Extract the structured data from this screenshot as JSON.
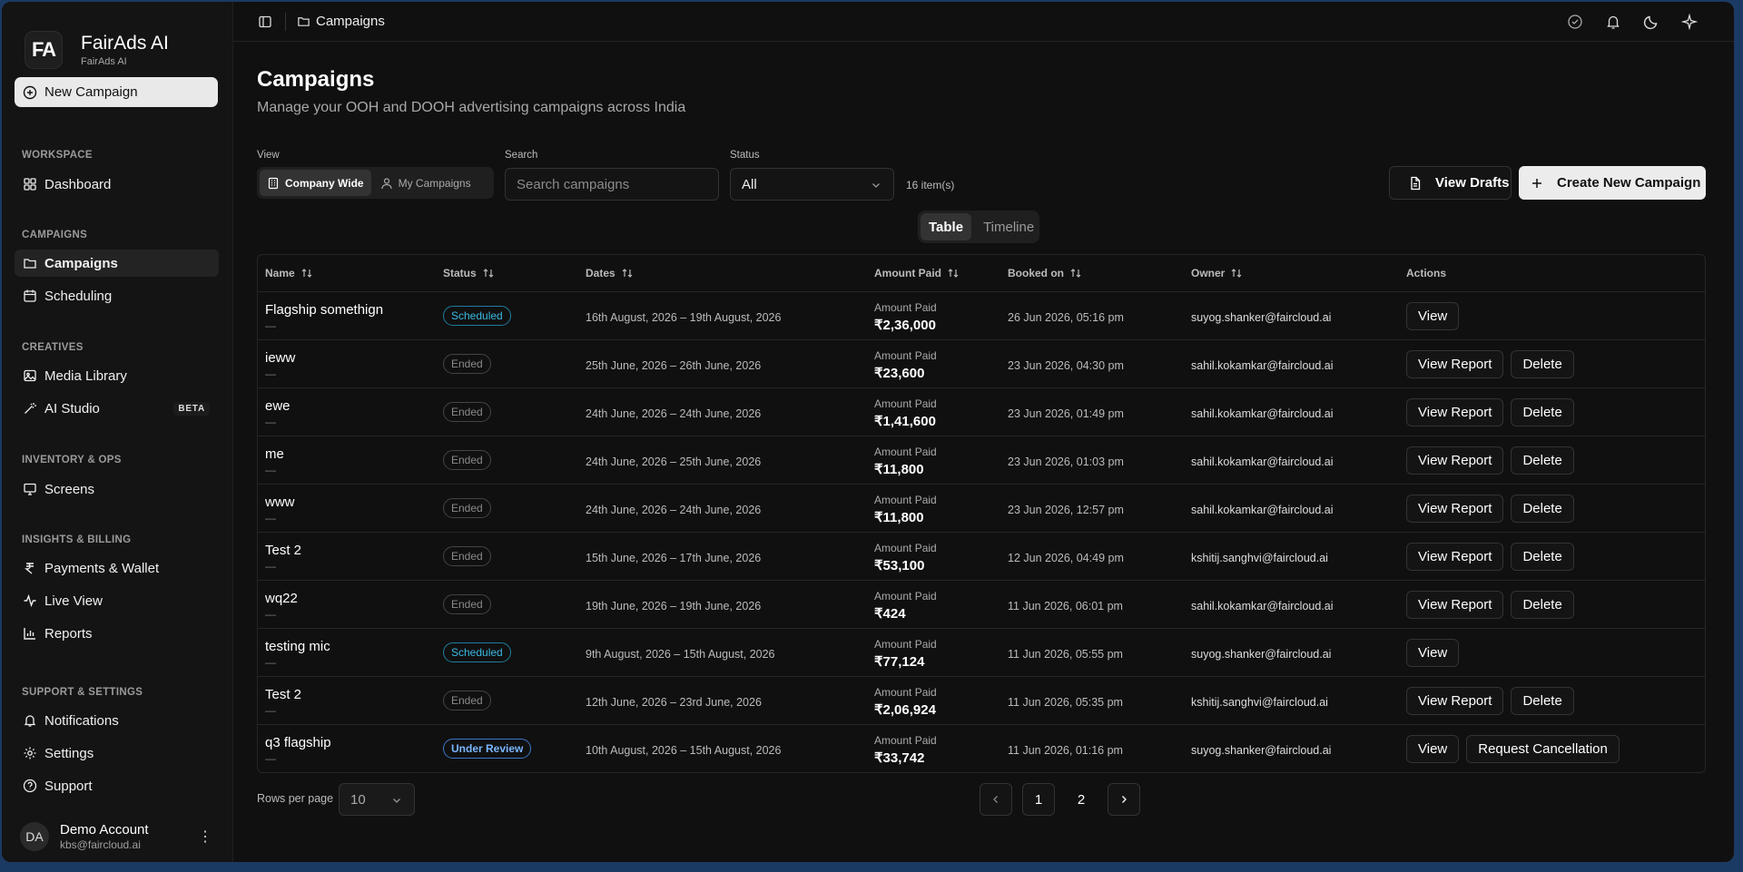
{
  "brand": {
    "logo": "FA",
    "name": "FairAds AI",
    "sub": "FairAds AI"
  },
  "sidebar": {
    "new_campaign": "New Campaign",
    "sections": {
      "workspace": "WORKSPACE",
      "campaigns": "CAMPAIGNS",
      "creatives": "CREATIVES",
      "inventory": "INVENTORY & OPS",
      "insights": "INSIGHTS & BILLING",
      "support": "SUPPORT & SETTINGS"
    },
    "items": {
      "dashboard": "Dashboard",
      "campaigns": "Campaigns",
      "scheduling": "Scheduling",
      "media_library": "Media Library",
      "ai_studio": "AI Studio",
      "ai_studio_badge": "BETA",
      "screens": "Screens",
      "payments": "Payments & Wallet",
      "live_view": "Live View",
      "reports": "Reports",
      "notifications": "Notifications",
      "settings": "Settings",
      "support": "Support"
    },
    "account": {
      "initials": "DA",
      "name": "Demo Account",
      "email": "kbs@faircloud.ai"
    }
  },
  "topbar": {
    "breadcrumb": "Campaigns"
  },
  "page": {
    "title": "Campaigns",
    "subtitle": "Manage your OOH and DOOH advertising campaigns across India"
  },
  "filters": {
    "view_label": "View",
    "view_company": "Company Wide",
    "view_mine": "My Campaigns",
    "search_label": "Search",
    "search_placeholder": "Search campaigns",
    "status_label": "Status",
    "status_value": "All",
    "item_count": "16 item(s)"
  },
  "actions": {
    "view_drafts": "View Drafts",
    "create": "Create New Campaign"
  },
  "mode_toggle": {
    "table": "Table",
    "timeline": "Timeline"
  },
  "table": {
    "headers": {
      "name": "Name",
      "status": "Status",
      "dates": "Dates",
      "amount": "Amount Paid",
      "booked": "Booked on",
      "owner": "Owner",
      "actions": "Actions"
    },
    "amount_label": "Amount Paid",
    "dash": "—",
    "rows": [
      {
        "name": "Flagship somethign",
        "status": "Scheduled",
        "dates": "16th August, 2026 – 19th August, 2026",
        "amount": "₹2,36,000",
        "booked": "26 Jun 2026, 05:16 pm",
        "owner": "suyog.shanker@faircloud.ai",
        "actions": [
          "View"
        ]
      },
      {
        "name": "ieww",
        "status": "Ended",
        "dates": "25th June, 2026 – 26th June, 2026",
        "amount": "₹23,600",
        "booked": "23 Jun 2026, 04:30 pm",
        "owner": "sahil.kokamkar@faircloud.ai",
        "actions": [
          "View Report",
          "Delete"
        ]
      },
      {
        "name": "ewe",
        "status": "Ended",
        "dates": "24th June, 2026 – 24th June, 2026",
        "amount": "₹1,41,600",
        "booked": "23 Jun 2026, 01:49 pm",
        "owner": "sahil.kokamkar@faircloud.ai",
        "actions": [
          "View Report",
          "Delete"
        ]
      },
      {
        "name": "me",
        "status": "Ended",
        "dates": "24th June, 2026 – 25th June, 2026",
        "amount": "₹11,800",
        "booked": "23 Jun 2026, 01:03 pm",
        "owner": "sahil.kokamkar@faircloud.ai",
        "actions": [
          "View Report",
          "Delete"
        ]
      },
      {
        "name": "www",
        "status": "Ended",
        "dates": "24th June, 2026 – 24th June, 2026",
        "amount": "₹11,800",
        "booked": "23 Jun 2026, 12:57 pm",
        "owner": "sahil.kokamkar@faircloud.ai",
        "actions": [
          "View Report",
          "Delete"
        ]
      },
      {
        "name": "Test 2",
        "status": "Ended",
        "dates": "15th June, 2026 – 17th June, 2026",
        "amount": "₹53,100",
        "booked": "12 Jun 2026, 04:49 pm",
        "owner": "kshitij.sanghvi@faircloud.ai",
        "actions": [
          "View Report",
          "Delete"
        ]
      },
      {
        "name": "wq22",
        "status": "Ended",
        "dates": "19th June, 2026 – 19th June, 2026",
        "amount": "₹424",
        "booked": "11 Jun 2026, 06:01 pm",
        "owner": "sahil.kokamkar@faircloud.ai",
        "actions": [
          "View Report",
          "Delete"
        ]
      },
      {
        "name": "testing mic",
        "status": "Scheduled",
        "dates": "9th August, 2026 – 15th August, 2026",
        "amount": "₹77,124",
        "booked": "11 Jun 2026, 05:55 pm",
        "owner": "suyog.shanker@faircloud.ai",
        "actions": [
          "View"
        ]
      },
      {
        "name": "Test 2",
        "status": "Ended",
        "dates": "12th June, 2026 – 23rd June, 2026",
        "amount": "₹2,06,924",
        "booked": "11 Jun 2026, 05:35 pm",
        "owner": "kshitij.sanghvi@faircloud.ai",
        "actions": [
          "View Report",
          "Delete"
        ]
      },
      {
        "name": "q3 flagship",
        "status": "Under Review",
        "dates": "10th August, 2026 – 15th August, 2026",
        "amount": "₹33,742",
        "booked": "11 Jun 2026, 01:16 pm",
        "owner": "suyog.shanker@faircloud.ai",
        "actions": [
          "View",
          "Request Cancellation"
        ]
      }
    ]
  },
  "pagination": {
    "rows_label": "Rows per page",
    "rows_value": "10",
    "pages": [
      "1",
      "2"
    ],
    "current": "1"
  },
  "colors": {
    "accent_scheduled": "#3ab7e0",
    "accent_review": "#7ab6ff",
    "background": "#101010"
  }
}
